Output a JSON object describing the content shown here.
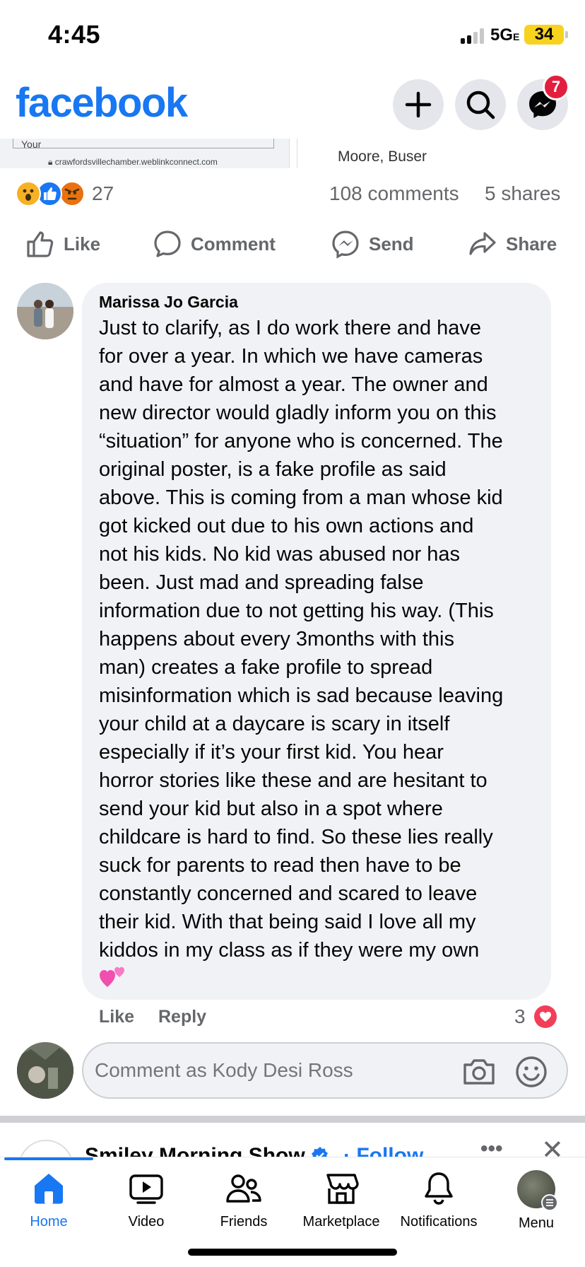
{
  "status_bar": {
    "time": "4:45",
    "network": "5G",
    "network_suffix": "E",
    "battery": "34",
    "battery_color": "#f7d21e"
  },
  "header": {
    "logo": "facebook",
    "brand_color": "#1877f2",
    "create_icon": "plus-icon",
    "search_icon": "search-icon",
    "messenger_icon": "messenger-icon",
    "messenger_badge": "7"
  },
  "link_preview": {
    "table_label": "Your",
    "url": "crawfordsvillechamber.weblinkconnect.com",
    "names": "Moore, Buser"
  },
  "post_stats": {
    "reaction_icons": [
      "wow-reaction-icon",
      "like-reaction-icon",
      "angry-reaction-icon"
    ],
    "reaction_count": "27",
    "comments": "108 comments",
    "shares": "5 shares"
  },
  "actions": {
    "like": "Like",
    "comment": "Comment",
    "send": "Send",
    "share": "Share"
  },
  "comment": {
    "author": "Marissa Jo Garcia",
    "text": "Just to clarify, as I do work there and have\nfor over a year. In which we have cameras\nand have for almost a year. The owner and\nnew director would gladly inform you on this\n“situation” for anyone who is concerned. The\noriginal poster, is a fake profile as said\nabove. This is coming from a man whose kid\ngot kicked out due to his own actions and\nnot his kids. No kid was abused nor has\nbeen. Just mad and spreading false\ninformation due to not getting his way. (This\nhappens about every 3months with this\nman) creates a fake profile to spread\nmisinformation which is sad because leaving\nyour child at a daycare is scary in itself\nespecially if it’s your first kid. You hear\nhorror stories like these and are hesitant to\nsend your kid but also in a spot where\nchildcare is hard to find. So these lies really\nsuck for parents to read then have to be\nconstantly concerned and scared to leave\ntheir kid. With that being said I love all my\nkiddos in my class as if they were my own",
    "emoji": "two-hearts-icon",
    "like_label": "Like",
    "reply_label": "Reply",
    "reaction_count": "3",
    "reaction_icon": "love-reaction-icon"
  },
  "composer": {
    "placeholder": "Comment as Kody Desi Ross"
  },
  "next_post": {
    "name": "Smiley Morning Show",
    "verified_icon": "verified-badge-icon",
    "follow": "· Follow"
  },
  "bottom_nav": {
    "items": [
      {
        "label": "Home",
        "icon": "home-icon",
        "active": true
      },
      {
        "label": "Video",
        "icon": "video-icon"
      },
      {
        "label": "Friends",
        "icon": "friends-icon"
      },
      {
        "label": "Marketplace",
        "icon": "marketplace-icon"
      },
      {
        "label": "Notifications",
        "icon": "bell-icon"
      },
      {
        "label": "Menu",
        "icon": "profile-avatar"
      }
    ]
  }
}
